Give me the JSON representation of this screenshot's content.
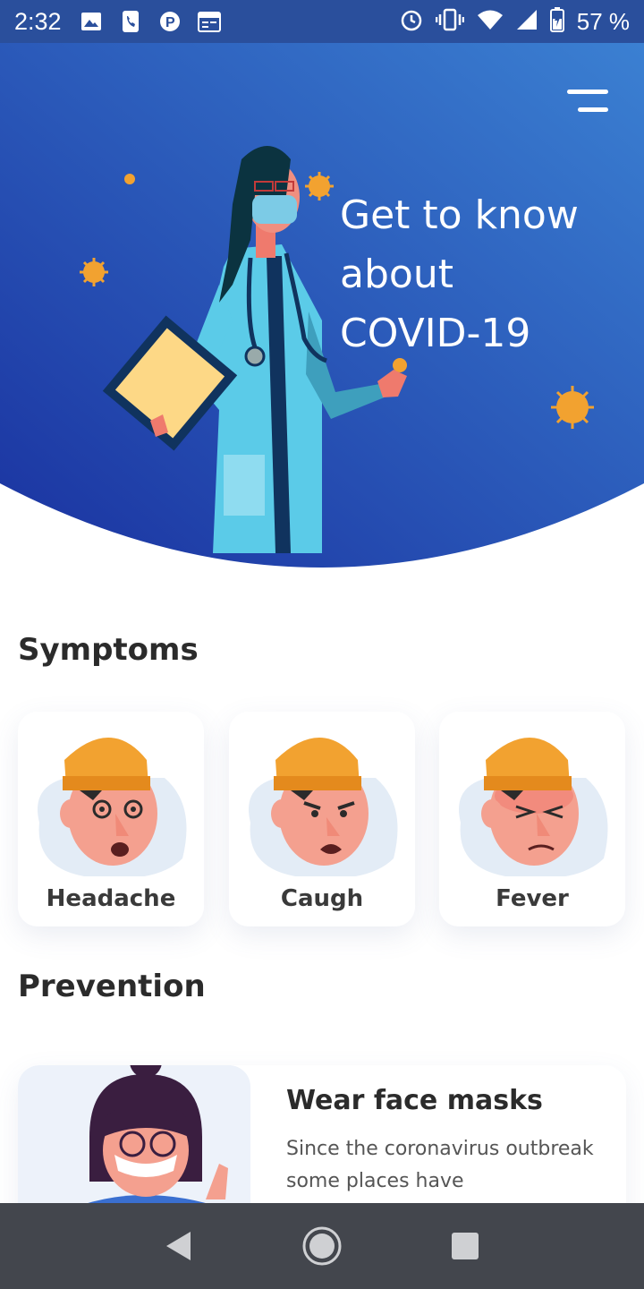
{
  "status_bar": {
    "time": "2:32",
    "battery_percent": "57 %",
    "left_icons": [
      "gallery-icon",
      "phone-icon",
      "parking-icon",
      "calendar-icon"
    ],
    "right_icons": [
      "alarm-icon",
      "vibrate-icon",
      "wifi-icon",
      "cell-signal-icon",
      "battery-icon"
    ]
  },
  "header": {
    "title_lines": [
      "Get to know",
      "about",
      "COVID-19"
    ],
    "gradient_start": "#1a3aa8",
    "gradient_end": "#3b7fd1"
  },
  "symptoms": {
    "title": "Symptoms",
    "items": [
      {
        "label": "Headache",
        "icon": "dizzy-face-icon"
      },
      {
        "label": "Caugh",
        "icon": "coughing-face-icon"
      },
      {
        "label": "Fever",
        "icon": "feverish-face-icon"
      }
    ]
  },
  "prevention": {
    "title": "Prevention",
    "items": [
      {
        "title": "Wear face masks",
        "text": "Since the coronavirus outbreak some places have"
      }
    ]
  },
  "nav_bar": {
    "buttons": [
      "back-icon",
      "home-icon",
      "recents-icon"
    ]
  },
  "colors": {
    "accent_orange": "#f2a230",
    "text_dark": "#2b2b2b",
    "nav_bg": "#43464d"
  }
}
